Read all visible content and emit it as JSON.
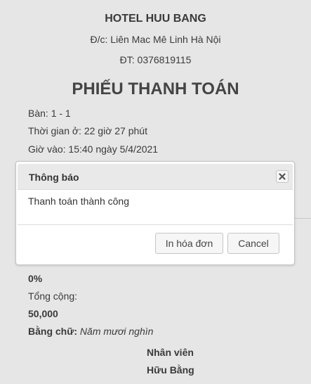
{
  "receipt": {
    "hotel_name": "HOTEL HUU BANG",
    "address": "Đ/c: Liên Mac Mê Linh Hà Nội",
    "phone": "ĐT: 0376819115",
    "title": "PHIẾU THANH TOÁN",
    "table": "Bàn: 1 - 1",
    "duration": "Thời gian ở: 22 giờ 27 phút",
    "checkin": "Giờ vào: 15:40 ngày 5/4/2021",
    "discount": "0%",
    "total_label": "Tổng cộng:",
    "total": "50,000",
    "amount_in_words_label": "Bằng chữ:",
    "amount_in_words": "Năm mươi nghìn",
    "signature_role": "Nhân viên",
    "signature_name": "Hữu Bằng"
  },
  "dialog": {
    "title": "Thông báo",
    "message": "Thanh toán thành công",
    "close_icon": "close-icon",
    "print_button": "In hóa đơn",
    "cancel_button": "Cancel"
  }
}
